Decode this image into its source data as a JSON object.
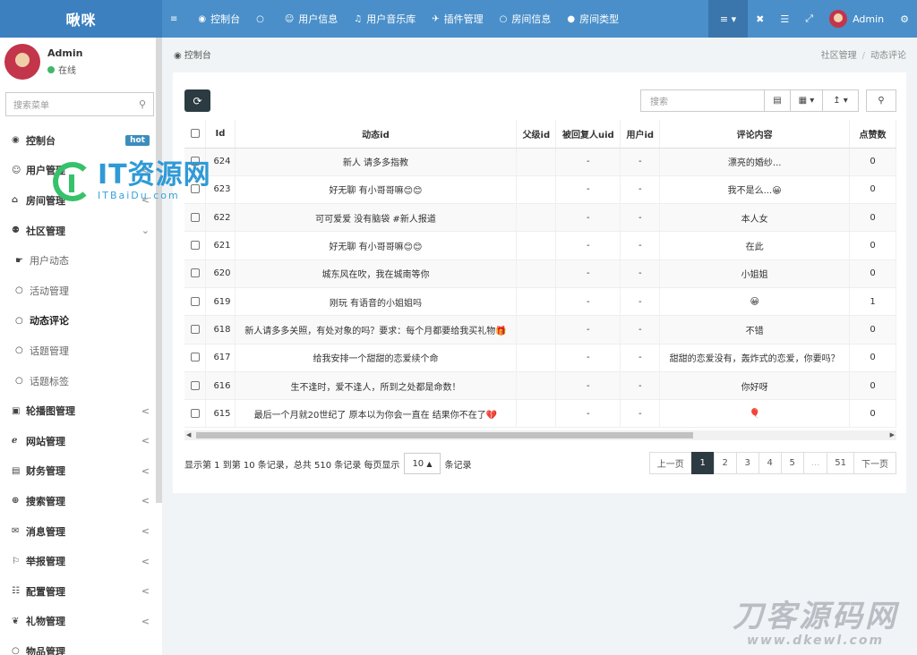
{
  "app": {
    "logo": "啾咪"
  },
  "topnav": [
    {
      "icon": "bars-icon",
      "label": ""
    },
    {
      "icon": "dashboard-icon",
      "label": "控制台"
    },
    {
      "icon": "circle-icon",
      "label": ""
    },
    {
      "icon": "user-icon",
      "label": "用户信息"
    },
    {
      "icon": "music-icon",
      "label": "用户音乐库"
    },
    {
      "icon": "plane-icon",
      "label": "插件管理"
    },
    {
      "icon": "circle-icon",
      "label": "房间信息"
    },
    {
      "icon": "circle-filled-icon",
      "label": "房间类型"
    }
  ],
  "topright": {
    "menu_icon": "list-caret-icon",
    "user": "Admin"
  },
  "sidebar": {
    "user": {
      "name": "Admin",
      "status": "在线"
    },
    "search_placeholder": "搜索菜单",
    "items": [
      {
        "icon": "dashboard-icon",
        "label": "控制台",
        "badge": "hot",
        "arrow": ""
      },
      {
        "icon": "user-icon",
        "label": "用户管理",
        "badge": "",
        "arrow": "<"
      },
      {
        "icon": "bank-icon",
        "label": "房间管理",
        "badge": "",
        "arrow": "<"
      },
      {
        "icon": "bicycle-icon",
        "label": "社区管理",
        "badge": "",
        "arrow": "⌄",
        "bold": true
      },
      {
        "icon": "hand-icon",
        "label": "用户动态",
        "sub": true
      },
      {
        "icon": "circle-icon",
        "label": "活动管理",
        "sub": true
      },
      {
        "icon": "circle-icon",
        "label": "动态评论",
        "sub": true,
        "active": true
      },
      {
        "icon": "circle-icon",
        "label": "话题管理",
        "sub": true
      },
      {
        "icon": "circle-icon",
        "label": "话题标签",
        "sub": true
      },
      {
        "icon": "image-icon",
        "label": "轮播图管理",
        "badge": "",
        "arrow": "<"
      },
      {
        "icon": "ie-icon",
        "label": "网站管理",
        "badge": "",
        "arrow": "<"
      },
      {
        "icon": "money-icon",
        "label": "财务管理",
        "badge": "",
        "arrow": "<"
      },
      {
        "icon": "search-plus-icon",
        "label": "搜索管理",
        "badge": "",
        "arrow": "<"
      },
      {
        "icon": "message-icon",
        "label": "消息管理",
        "badge": "",
        "arrow": "<"
      },
      {
        "icon": "report-icon",
        "label": "举报管理",
        "badge": "",
        "arrow": "<"
      },
      {
        "icon": "sitemap-icon",
        "label": "配置管理",
        "badge": "",
        "arrow": "<"
      },
      {
        "icon": "gift-icon",
        "label": "礼物管理",
        "badge": "",
        "arrow": "<"
      },
      {
        "icon": "circle-icon",
        "label": "物品管理",
        "badge": "",
        "arrow": ""
      }
    ]
  },
  "breadcrumb": {
    "title": "控制台",
    "trail": [
      "社区管理",
      "动态评论"
    ]
  },
  "toolbar": {
    "search_placeholder": "搜索"
  },
  "table": {
    "headers": [
      "Id",
      "动态id",
      "父级id",
      "被回复人uid",
      "用户id",
      "评论内容",
      "点赞数"
    ],
    "rows": [
      [
        "624",
        "新人 请多多指教",
        "",
        "-",
        "-",
        "漂亮的婚纱...",
        "0"
      ],
      [
        "623",
        "好无聊 有小哥哥嘛😊😊",
        "",
        "-",
        "-",
        "我不是么...😀",
        "0"
      ],
      [
        "622",
        "可可爱爱 没有脑袋 #新人报道",
        "",
        "-",
        "-",
        "本人女",
        "0"
      ],
      [
        "621",
        "好无聊 有小哥哥嘛😊😊",
        "",
        "-",
        "-",
        "在此",
        "0"
      ],
      [
        "620",
        "城东风在吹，我在城南等你",
        "",
        "-",
        "-",
        "小姐姐",
        "0"
      ],
      [
        "619",
        "刚玩 有语音的小姐姐吗",
        "",
        "-",
        "-",
        "😀",
        "1"
      ],
      [
        "618",
        "新人请多多关照，有处对象的吗？要求：每个月都要给我买礼物🎁",
        "",
        "-",
        "-",
        "不错",
        "0"
      ],
      [
        "617",
        "给我安排一个甜甜的恋爱续个命",
        "",
        "-",
        "-",
        "甜甜的恋爱没有，轰炸式的恋爱，你要吗？",
        "0"
      ],
      [
        "616",
        "生不逢时，爱不逢人，所到之处都是命数！",
        "",
        "-",
        "-",
        "你好呀",
        "0"
      ],
      [
        "615",
        "最后一个月就20世纪了 原本以为你会一直在 结果你不在了💔",
        "",
        "-",
        "-",
        "🎈",
        "0"
      ]
    ]
  },
  "footer": {
    "info_before": "显示第 1 到第 10 条记录，总共 510 条记录 每页显示",
    "page_size": "10",
    "info_after": "条记录"
  },
  "pager": {
    "prev": "上一页",
    "pages": [
      "1",
      "2",
      "3",
      "4",
      "5",
      "...",
      "51"
    ],
    "next": "下一页",
    "current": "1"
  },
  "watermarks": {
    "top_main": "IT资源网",
    "top_sub": "ITBaiDu.com",
    "bottom_main": "刀客源码网",
    "bottom_sub": "www.dkewl.com"
  }
}
